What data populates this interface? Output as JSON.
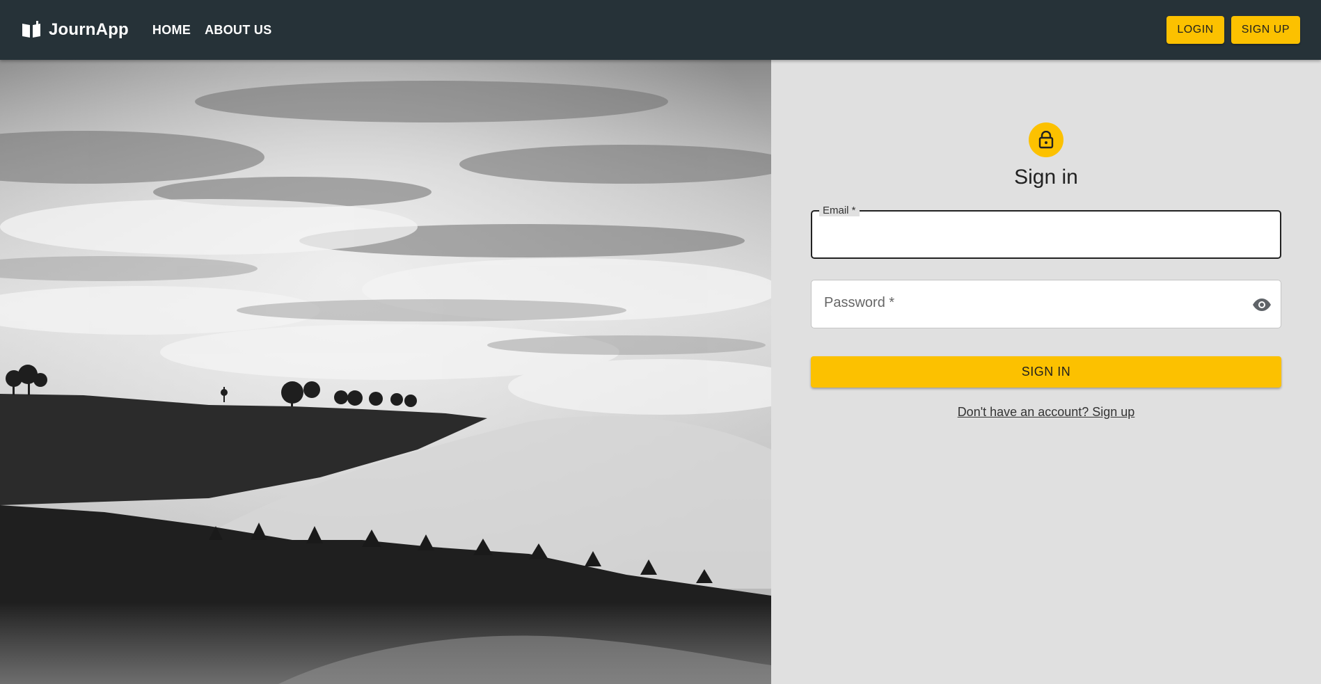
{
  "header": {
    "brand": "JournApp",
    "brand_icon": "open-book-icon",
    "nav": {
      "home": "HOME",
      "about": "ABOUT US"
    },
    "login_label": "LOGIN",
    "signup_label": "SIGN UP"
  },
  "hero": {
    "image_subject": "black-and-white landscape of clouds rolling over forested hills"
  },
  "form": {
    "icon": "lock-icon",
    "title": "Sign in",
    "email_label": "Email *",
    "email_value": "",
    "password_label": "Password *",
    "password_value": "",
    "password_toggle_icon": "eye-icon",
    "submit_label": "SIGN IN",
    "signup_link": "Don't have an account? Sign up"
  },
  "colors": {
    "appbar": "#263238",
    "accent": "#fcc100",
    "panel": "#e0e0e0"
  }
}
